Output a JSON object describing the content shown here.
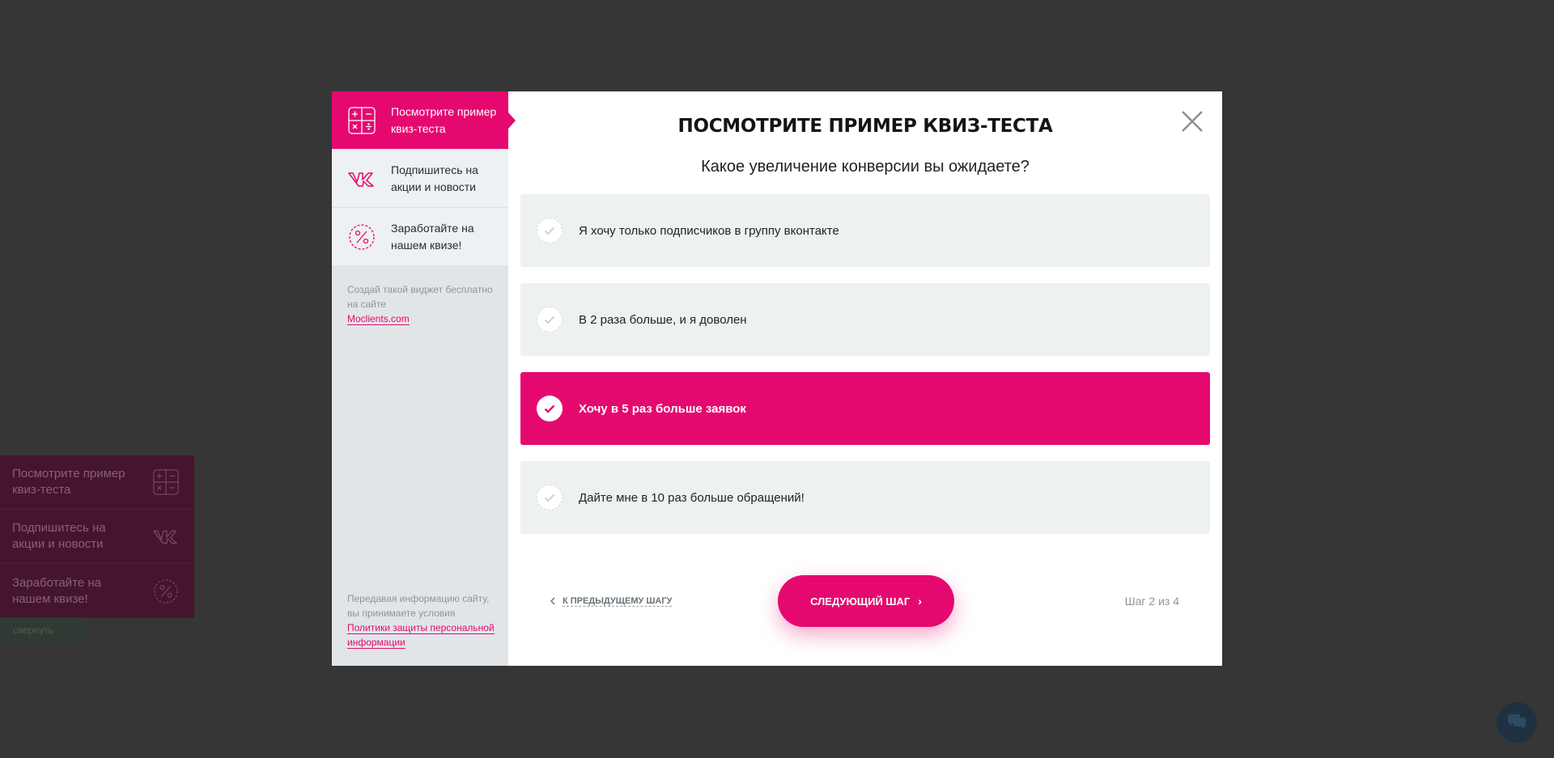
{
  "background_widget": {
    "items": [
      {
        "label": "Посмотрите пример квиз-теста",
        "icon": "calculator-icon"
      },
      {
        "label": "Подпишитесь на акции и новости",
        "icon": "vk-icon"
      },
      {
        "label": "Заработайте на нашем квизе!",
        "icon": "percent-badge-icon"
      }
    ],
    "collapse_label": "свернуть"
  },
  "sidebar": {
    "items": [
      {
        "label": "Посмотрите пример квиз-теста",
        "icon": "calculator-icon",
        "active": true
      },
      {
        "label": "Подпишитесь на акции и новости",
        "icon": "vk-icon",
        "active": false
      },
      {
        "label": "Заработайте на нашем квизе!",
        "icon": "percent-badge-icon",
        "active": false
      }
    ],
    "promo_text": "Создай такой виджет бесплатно на сайте",
    "promo_link": "Moclients.com",
    "legal_text": "Передавая информацию сайту, вы принимаете условия",
    "legal_link": "Политики защиты персональной информации"
  },
  "quiz": {
    "title": "ПОСМОТРИТЕ ПРИМЕР КВИЗ-ТЕСТА",
    "question": "Какое увеличение конверсии вы ожидаете?",
    "answers": [
      {
        "text": "Я хочу только подписчиков в группу вконтакте",
        "selected": false
      },
      {
        "text": "В 2 раза больше, и я доволен",
        "selected": false
      },
      {
        "text": "Хочу в 5 раз больше заявок",
        "selected": true
      },
      {
        "text": "Дайте мне в 10 раз больше обращений!",
        "selected": false
      }
    ],
    "prev_label": "К предыдущему шагу",
    "next_label": "Следующий шаг",
    "step_info": "Шаг 2 из 4"
  },
  "colors": {
    "accent": "#e5096f",
    "overlay": "#363636",
    "sidebar_bg": "#e1e5e8",
    "answer_bg": "#eef1f2"
  }
}
